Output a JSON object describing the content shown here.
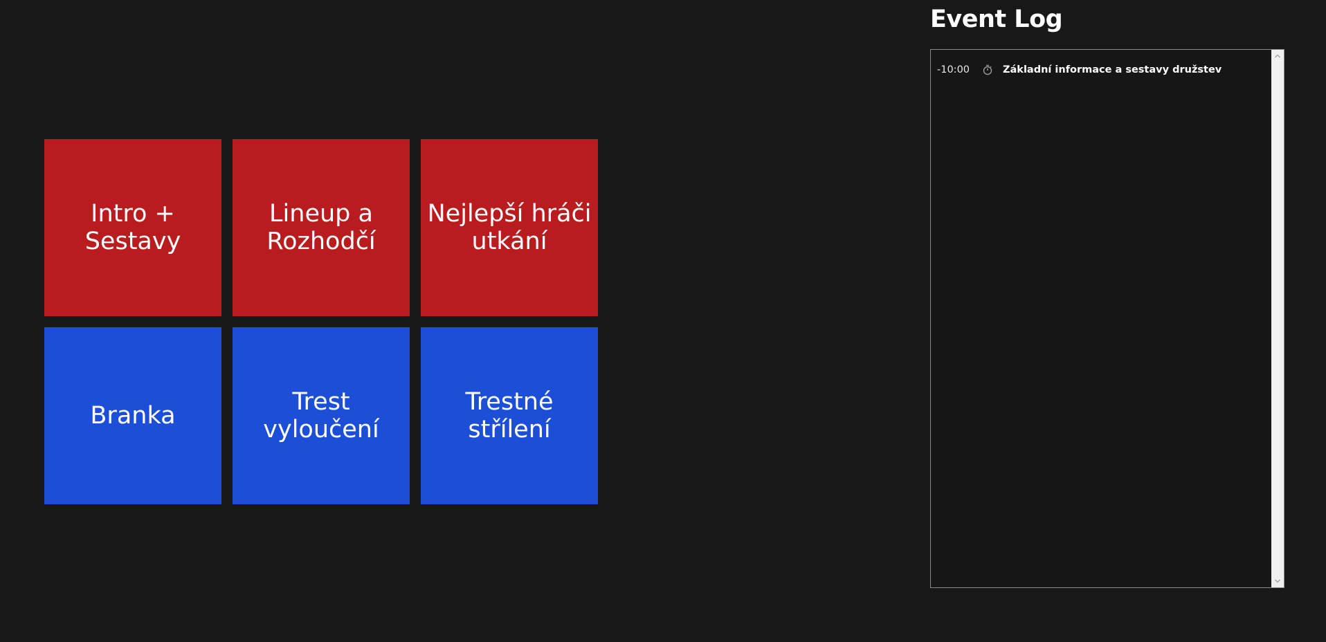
{
  "tiles": [
    {
      "label": "Intro + Sestavy",
      "color": "#b81c1e"
    },
    {
      "label": "Lineup a Rozhodčí",
      "color": "#b81c1e"
    },
    {
      "label": "Nejlepší hráči utkání",
      "color": "#b81c1e"
    },
    {
      "label": "Branka",
      "color": "#1c4ed8"
    },
    {
      "label": "Trest vyloučení",
      "color": "#1c4ed8"
    },
    {
      "label": "Trestné střílení",
      "color": "#1c4ed8"
    }
  ],
  "event_log": {
    "title": "Event Log",
    "entries": [
      {
        "time": "-10:00",
        "icon": "stopwatch-icon",
        "text": "Základní informace a sestavy družstev"
      }
    ]
  },
  "colors": {
    "background": "#181818",
    "red_tile": "#b81c1e",
    "blue_tile": "#1c4ed8"
  }
}
